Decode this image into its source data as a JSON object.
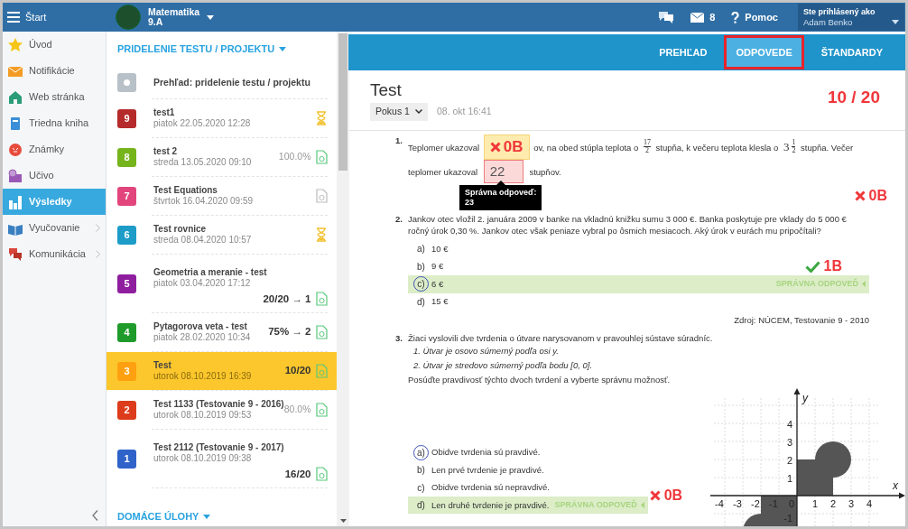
{
  "topbar": {
    "menu_label": "Štart",
    "subject": "Matematika",
    "class_name": "9.A",
    "messages_count": "8",
    "help": "Pomoc",
    "user_caption": "Ste prihlásený ako",
    "user_name": "Adam Benko"
  },
  "sidebar": {
    "items": [
      {
        "label": "Úvod",
        "kind": "star",
        "selected": false,
        "has_submenu": false
      },
      {
        "label": "Notifikácie",
        "kind": "envelope",
        "selected": false,
        "has_submenu": false
      },
      {
        "label": "Web stránka",
        "kind": "house",
        "selected": false,
        "has_submenu": false
      },
      {
        "label": "Triedna kniha",
        "kind": "book",
        "selected": false,
        "has_submenu": false
      },
      {
        "label": "Známky",
        "kind": "grades",
        "selected": false,
        "has_submenu": false
      },
      {
        "label": "Učivo",
        "kind": "monitor",
        "selected": false,
        "has_submenu": false
      },
      {
        "label": "Výsledky",
        "kind": "chart",
        "selected": true,
        "has_submenu": false
      },
      {
        "label": "Vyučovanie",
        "kind": "openbook",
        "selected": false,
        "has_submenu": true
      },
      {
        "label": "Komunikácia",
        "kind": "chat",
        "selected": false,
        "has_submenu": true
      }
    ]
  },
  "assignments": {
    "heading": "PRIDELENIE TESTU / PROJEKTU",
    "overview": "Prehľad: pridelenie testu / projektu",
    "homework_heading": "DOMÁCE ÚLOHY",
    "items": [
      {
        "number": "9",
        "color": "#b52b2b",
        "title": "test1",
        "date": "piatok 22.05.2020 12:28",
        "kind": "hourglass",
        "result_below": false,
        "selected": false
      },
      {
        "number": "8",
        "color": "#76b41c",
        "title": "test 2",
        "date": "streda 13.05.2020 09:10",
        "result": "100.0%",
        "result_bold": false,
        "kind": "doc-done",
        "result_below": false,
        "selected": false
      },
      {
        "number": "7",
        "color": "#e2457c",
        "title": "Test Equations",
        "date": "štvrtok 16.04.2020 09:59",
        "kind": "doc",
        "result_below": false,
        "selected": false
      },
      {
        "number": "6",
        "color": "#1c9cc7",
        "title": "Test rovnice",
        "date": "streda 08.04.2020 10:57",
        "kind": "hourglass",
        "result_below": false,
        "selected": false
      },
      {
        "number": "5",
        "color": "#8f1e9f",
        "title": "Geometria a meranie - test",
        "date": "piatok 03.04.2020 17:12",
        "result": "20/20 → 1",
        "result_bold": true,
        "kind": "doc-done",
        "result_below": true,
        "selected": false
      },
      {
        "number": "4",
        "color": "#1f9b2b",
        "title": "Pytagorova veta - test",
        "date": "piatok 28.02.2020 10:34",
        "result": "75% → 2",
        "result_bold": true,
        "kind": "doc-done",
        "result_below": false,
        "selected": false
      },
      {
        "number": "3",
        "color": "#ffa010",
        "title": "Test",
        "date": "utorok 08.10.2019 16:39",
        "result": "10/20",
        "result_bold": true,
        "kind": "doc-done",
        "result_below": false,
        "selected": true
      },
      {
        "number": "2",
        "color": "#dc3c1c",
        "title": "Test 1133 (Testovanie 9 - 2016)",
        "date": "utorok 08.10.2019 09:53",
        "result": "80.0%",
        "result_bold": false,
        "kind": "doc-done",
        "result_below": false,
        "selected": false
      },
      {
        "number": "1",
        "color": "#2f63ca",
        "title": "Test 2112 (Testovanie 9 - 2017)",
        "date": "utorok 08.10.2019 09:38",
        "result": "16/20",
        "result_bold": true,
        "kind": "doc-done",
        "result_below": true,
        "selected": false
      }
    ]
  },
  "test": {
    "tabs": [
      {
        "label": "PREHĽAD",
        "selected": false
      },
      {
        "label": "ODPOVEDE",
        "selected": true
      },
      {
        "label": "ŠTANDARDY",
        "selected": false
      }
    ],
    "title": "Test",
    "attempt": "Pokus 1",
    "date": "08. okt 16:41",
    "score": "10 / 20",
    "questions": [
      {
        "number": "1.",
        "kind": "fill",
        "parts": [
          {
            "kind": "text",
            "text": "Teplomer ukazoval"
          },
          {
            "kind": "badge",
            "text": "0B"
          },
          {
            "kind": "text",
            "text": "ov, na obed stúpla teplota o"
          },
          {
            "kind": "fraction",
            "numerator": "17",
            "denominator": "2"
          },
          {
            "kind": "text",
            "text": "stupňa, k večeru teplota klesla o"
          },
          {
            "kind": "mixed",
            "whole": "3",
            "numerator": "1",
            "denominator": "2"
          },
          {
            "kind": "text",
            "text": "stupňa. Večer"
          },
          {
            "kind": "break"
          },
          {
            "kind": "text",
            "text": "teplomer ukazoval"
          },
          {
            "kind": "input",
            "value": "22",
            "correct": false
          },
          {
            "kind": "text",
            "text": "stupňov."
          }
        ],
        "tooltip": {
          "title": "Správna odpoveď:",
          "value": "23"
        },
        "points": "0B",
        "points_correct": false
      },
      {
        "number": "2.",
        "kind": "choice",
        "text": "Jankov otec vložil 2. januára 2009 v banke na vkladnú knižku sumu 3 000 €. Banka poskytuje pre vklady do 5 000 € ročný úrok 0,30 %. Jankov otec však peniaze vybral po ôsmich mesiacoch. Aký úrok v eurách mu pripočítali?",
        "options": [
          {
            "letter": "a)",
            "text": "10 €",
            "selected": false,
            "correct": false
          },
          {
            "letter": "b)",
            "text": "9 €",
            "selected": false,
            "correct": false
          },
          {
            "letter": "c)",
            "text": "6 €",
            "selected": true,
            "correct": true
          },
          {
            "letter": "d)",
            "text": "15 €",
            "selected": false,
            "correct": false
          }
        ],
        "correct_label": "SPRÁVNA ODPOVEĎ",
        "points": "1B",
        "points_correct": true,
        "source": "Zdroj: NÚCEM, Testovanie 9 - 2010"
      },
      {
        "number": "3.",
        "kind": "choice",
        "text": "Žiaci vyslovili dve tvrdenia o útvare narysovanom v pravouhlej sústave súradníc.",
        "statements": [
          "1. Útvar je osovo súmerný podľa osi y.",
          "2. Útvar je stredovo súmerný podľa bodu [0, 0]."
        ],
        "instruction": "Posúďte pravdivosť týchto dvoch tvrdení a vyberte správnu možnosť.",
        "options": [
          {
            "letter": "a)",
            "text": "Obidve tvrdenia sú pravdivé.",
            "selected": true,
            "correct": false
          },
          {
            "letter": "b)",
            "text": "Len prvé tvrdenie je pravdivé.",
            "selected": false,
            "correct": false
          },
          {
            "letter": "c)",
            "text": "Obidve tvrdenia sú nepravdivé.",
            "selected": false,
            "correct": false
          },
          {
            "letter": "d)",
            "text": "Len druhé tvrdenie je pravdivé.",
            "selected": false,
            "correct": true
          }
        ],
        "correct_label": "SPRÁVNA ODPOVEĎ",
        "points": "0B",
        "points_correct": false,
        "graph": {
          "x_label": "x",
          "y_label": "y",
          "x_ticks": [
            "-4",
            "-3",
            "-2",
            "-1",
            "0",
            "1",
            "2",
            "3",
            "4"
          ],
          "y_ticks": [
            "4",
            "3",
            "2",
            "1",
            "-1"
          ]
        }
      }
    ]
  }
}
